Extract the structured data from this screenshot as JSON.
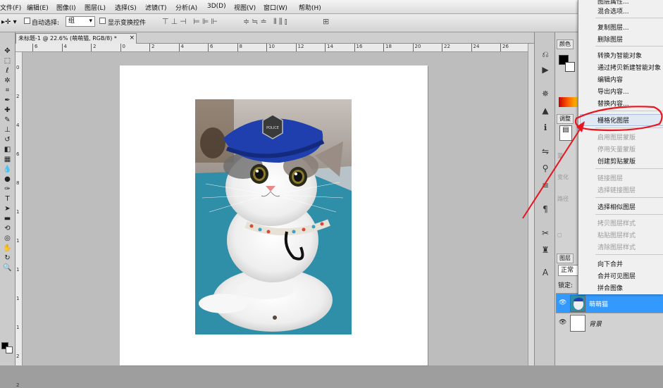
{
  "menubar": {
    "items": [
      "文件(F)",
      "编辑(E)",
      "图像(I)",
      "图层(L)",
      "选择(S)",
      "滤镜(T)",
      "分析(A)",
      "3D(D)",
      "视图(V)",
      "窗口(W)",
      "帮助(H)"
    ]
  },
  "options_bar": {
    "auto_select_label": "自动选择:",
    "auto_select_value": "组",
    "show_transform_label": "显示变换控件"
  },
  "document": {
    "tab_title": "未标题-1 @ 22.6% (萌萌猫, RGB/8) *",
    "tab_close": "×"
  },
  "ruler": {
    "h_ticks": [
      "6",
      "4",
      "2",
      "0",
      "2",
      "4",
      "6",
      "8",
      "10",
      "12",
      "14",
      "16",
      "18",
      "20",
      "22",
      "24",
      "26"
    ],
    "v_ticks": [
      "0",
      "2",
      "4",
      "6",
      "8",
      "1",
      "1",
      "1",
      "1",
      "1",
      "2",
      "2"
    ]
  },
  "panels": {
    "color_tab": "颜色",
    "layers_tab": "图层",
    "blend_mode": "正常",
    "lock_label": "锁定:",
    "faded_labels": [
      "调整",
      "蒙",
      "变化",
      "",
      "路径",
      "◻"
    ],
    "layers": [
      {
        "name": "萌萌猫",
        "selected": true
      },
      {
        "name": "背景",
        "selected": false
      }
    ]
  },
  "context_menu": {
    "items": [
      {
        "label": "图层属性...",
        "disabled": false
      },
      {
        "label": "混合选项...",
        "disabled": false
      },
      {
        "label": "复制图层...",
        "disabled": false
      },
      {
        "label": "删除图层",
        "disabled": false
      },
      {
        "label": "转换为智能对象",
        "disabled": false
      },
      {
        "label": "通过拷贝新建智能对象",
        "disabled": false
      },
      {
        "label": "编辑内容",
        "disabled": false
      },
      {
        "label": "导出内容...",
        "disabled": false
      },
      {
        "label": "替换内容...",
        "disabled": false
      },
      {
        "label": "栅格化图层",
        "disabled": false,
        "highlighted": true
      },
      {
        "label": "启用图层蒙版",
        "disabled": true
      },
      {
        "label": "停用矢量蒙版",
        "disabled": true
      },
      {
        "label": "创建剪贴蒙版",
        "disabled": false
      },
      {
        "label": "链接图层",
        "disabled": true
      },
      {
        "label": "选择链接图层",
        "disabled": true
      },
      {
        "label": "选择相似图层",
        "disabled": false
      },
      {
        "label": "拷贝图层样式",
        "disabled": true
      },
      {
        "label": "粘贴图层样式",
        "disabled": true
      },
      {
        "label": "清除图层样式",
        "disabled": true
      },
      {
        "label": "向下合并",
        "disabled": false
      },
      {
        "label": "合并可见图层",
        "disabled": false
      },
      {
        "label": "拼合图像",
        "disabled": false
      }
    ]
  },
  "photo": {
    "badge_text": "POLICE"
  },
  "colors": {
    "annotation_red": "#e8141e",
    "selection_blue": "#3399ff",
    "hat_blue": "#1f3fae",
    "table_teal": "#2f8fa8"
  }
}
